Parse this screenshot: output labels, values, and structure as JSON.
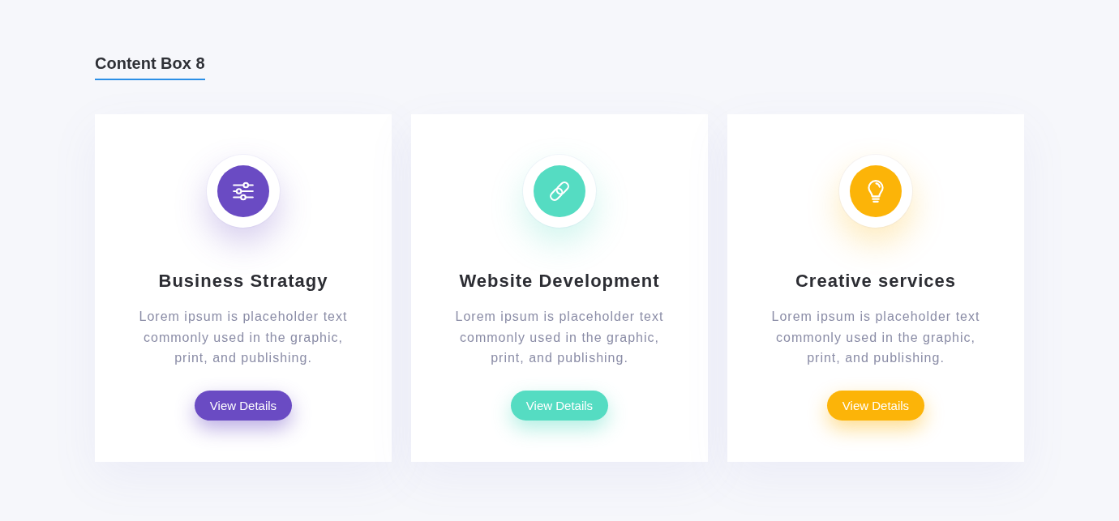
{
  "heading": {
    "title": "Content Box 8"
  },
  "cards": [
    {
      "kind": "sliders",
      "color": "#6a4bc3",
      "title": "Business Stratagy",
      "text": "Lorem ipsum is placeholder text commonly used in the graphic, print, and publishing.",
      "button": "View Details"
    },
    {
      "kind": "link",
      "color": "#55dcc2",
      "title": "Website Development",
      "text": "Lorem ipsum is placeholder text commonly used in the graphic, print, and publishing.",
      "button": "View Details"
    },
    {
      "kind": "bulb",
      "color": "#fcb408",
      "title": "Creative services",
      "text": "Lorem ipsum is placeholder text commonly used in the graphic, print, and publishing.",
      "button": "View Details"
    }
  ]
}
